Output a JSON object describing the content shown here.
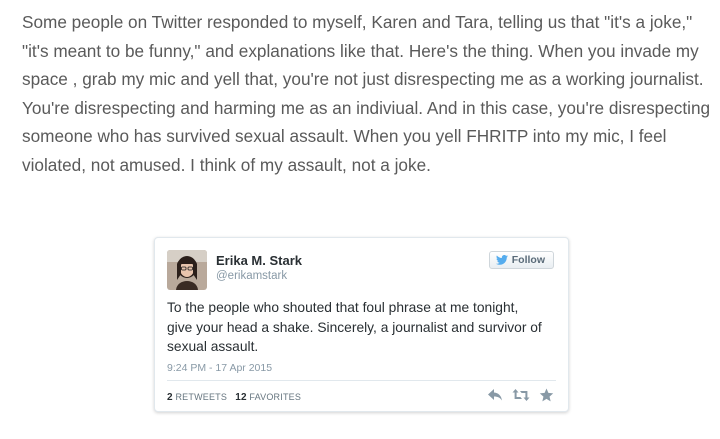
{
  "article": {
    "paragraph": "Some people on Twitter responded to myself, Karen and Tara, telling us that \"it's a joke,\" \"it's meant to be funny,\" and explanations like that. Here's the thing. When you invade my space , grab my mic and yell that, you're not just disrespecting me as a working journalist. You're disrespecting and harming me as an indiviual. And in this case, you're disrespecting someone who has survived sexual assault. When you yell FHRITP into my mic, I feel violated, not amused. I think of my assault, not a joke."
  },
  "tweet": {
    "author_name": "Erika M. Stark",
    "author_handle": "@erikamstark",
    "follow_label": "Follow",
    "text": "To the people who shouted that foul phrase at me tonight, give your head a shake. Sincerely,  a journalist and survivor of sexual assault.",
    "timestamp": "9:24 PM - 17 Apr 2015",
    "retweets_count": "2",
    "retweets_label": "RETWEETS",
    "favorites_count": "12",
    "favorites_label": "FAVORITES"
  },
  "icons": {
    "follow_bird": "twitter-bird-icon",
    "reply": "reply-icon",
    "retweet": "retweet-icon",
    "favorite": "star-icon"
  },
  "colors": {
    "article_text": "#5a5a5a",
    "tweet_text": "#292f33",
    "meta_text": "#8899a6",
    "twitter_blue": "#55acee",
    "action_icons": "#8899a6"
  }
}
